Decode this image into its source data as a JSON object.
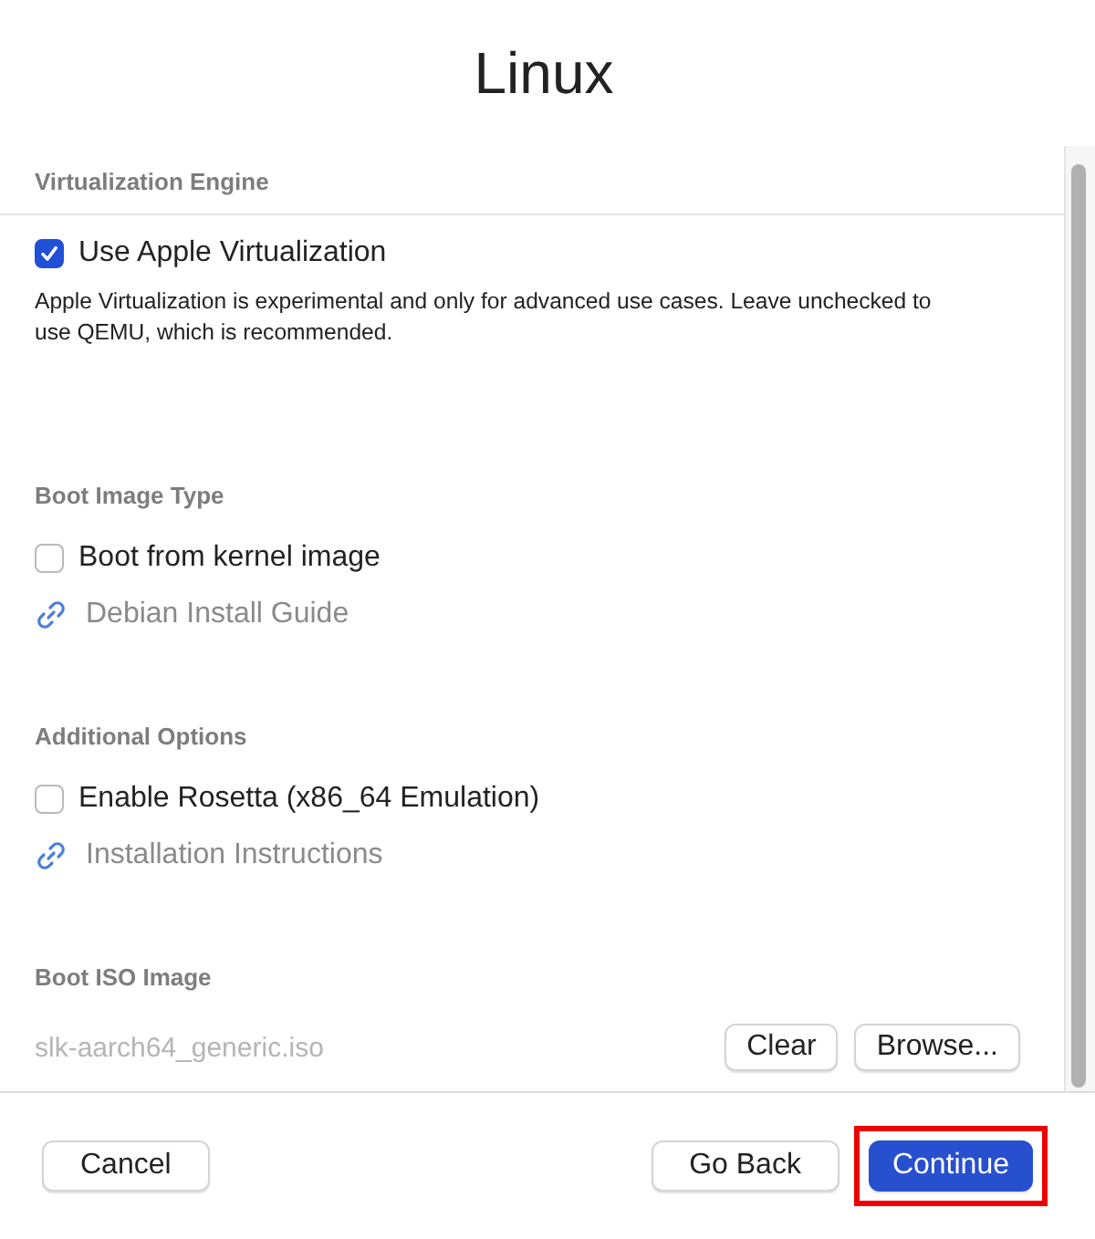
{
  "window": {
    "title": "Linux"
  },
  "sections": [
    {
      "title": "Virtualization Engine",
      "items": [
        {
          "kind": "checkbox",
          "label": "Use Apple Virtualization",
          "checked": true
        },
        {
          "kind": "note",
          "text": "Apple Virtualization is experimental and only for advanced use cases. Leave unchecked to use QEMU, which is recommended."
        }
      ]
    },
    {
      "title": "Boot Image Type",
      "items": [
        {
          "kind": "checkbox",
          "label": "Boot from kernel image",
          "checked": false
        },
        {
          "kind": "link",
          "label": "Debian Install Guide"
        }
      ]
    },
    {
      "title": "Additional Options",
      "items": [
        {
          "kind": "checkbox",
          "label": "Enable Rosetta (x86_64 Emulation)",
          "checked": false
        },
        {
          "kind": "link",
          "label": "Installation Instructions"
        }
      ]
    },
    {
      "title": "Boot ISO Image",
      "items": [
        {
          "kind": "file",
          "placeholder": "slk-aarch64_generic.iso",
          "buttons": [
            "Clear",
            "Browse..."
          ]
        }
      ]
    }
  ],
  "footer": {
    "buttons": [
      {
        "label": "Cancel",
        "kind": "plain",
        "highlighted": false
      },
      {
        "label": "Go Back",
        "kind": "plain",
        "highlighted": false
      },
      {
        "label": "Continue",
        "kind": "primary",
        "highlighted": true
      }
    ]
  }
}
